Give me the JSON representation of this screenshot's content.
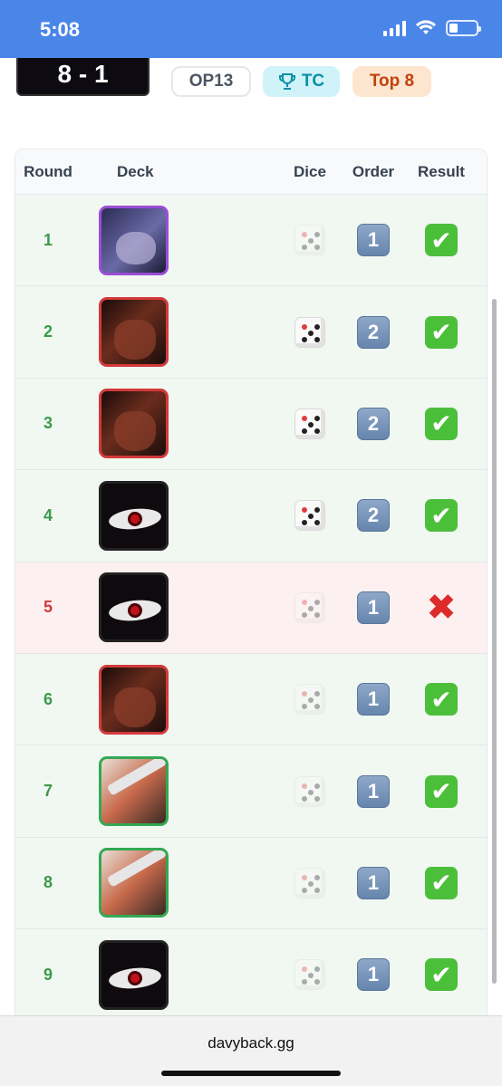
{
  "status_bar": {
    "time": "5:08"
  },
  "header": {
    "score": "8 - 1",
    "tags": {
      "set": "OP13",
      "event": "TC",
      "placement": "Top 8"
    }
  },
  "table": {
    "columns": [
      "Round",
      "Deck",
      "Dice",
      "Order",
      "Result"
    ],
    "rows": [
      {
        "round": "1",
        "deck": "purple",
        "dice": "faded",
        "order": "1",
        "result": "win"
      },
      {
        "round": "2",
        "deck": "red",
        "dice": "solid",
        "order": "2",
        "result": "win"
      },
      {
        "round": "3",
        "deck": "red",
        "dice": "solid",
        "order": "2",
        "result": "win"
      },
      {
        "round": "4",
        "deck": "dark",
        "dice": "solid",
        "order": "2",
        "result": "win"
      },
      {
        "round": "5",
        "deck": "dark",
        "dice": "faded",
        "order": "1",
        "result": "loss"
      },
      {
        "round": "6",
        "deck": "red",
        "dice": "faded",
        "order": "1",
        "result": "win"
      },
      {
        "round": "7",
        "deck": "green",
        "dice": "faded",
        "order": "1",
        "result": "win"
      },
      {
        "round": "8",
        "deck": "green",
        "dice": "faded",
        "order": "1",
        "result": "win"
      },
      {
        "round": "9",
        "deck": "dark",
        "dice": "faded",
        "order": "1",
        "result": "win"
      }
    ]
  },
  "browser": {
    "url": "davyback.gg"
  },
  "colors": {
    "status_bar": "#4a86e8",
    "win_row": "#f0f8f1",
    "loss_row": "#fdf0f0",
    "win_text": "#3b9a4a",
    "loss_text": "#d43a3a"
  }
}
